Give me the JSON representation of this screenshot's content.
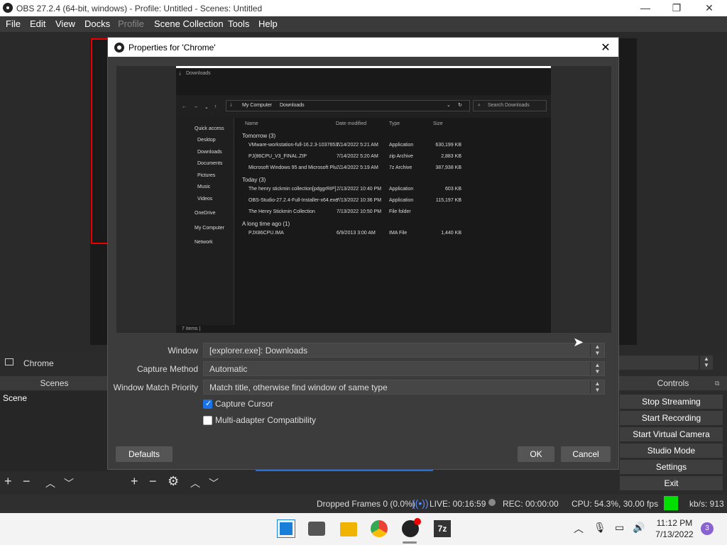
{
  "window": {
    "title": "OBS 27.2.4 (64-bit, windows) - Profile: Untitled - Scenes: Untitled",
    "min": "—",
    "max": "❐",
    "close": "✕"
  },
  "menu": [
    "File",
    "Edit",
    "View",
    "Docks",
    "Profile",
    "Scene Collection",
    "Tools",
    "Help"
  ],
  "dialog": {
    "title": "Properties for 'Chrome'",
    "close": "✕",
    "window_label": "Window",
    "window_value": "[explorer.exe]: Downloads",
    "method_label": "Capture Method",
    "method_value": "Automatic",
    "priority_label": "Window Match Priority",
    "priority_value": "Match title, otherwise find window of same type",
    "capture_cursor": "Capture Cursor",
    "capture_cursor_checked": true,
    "multi_adapter": "Multi-adapter Compatibility",
    "multi_adapter_checked": false,
    "defaults": "Defaults",
    "ok": "OK",
    "cancel": "Cancel"
  },
  "explorer": {
    "title": "Downloads",
    "path_a": "My Computer",
    "path_b": "Downloads",
    "search": "Search Downloads",
    "nav": [
      "Quick access",
      "Desktop",
      "Downloads",
      "Documents",
      "Pictures",
      "Music",
      "Videos",
      "OneDrive",
      "My Computer",
      "Network"
    ],
    "col_name": "Name",
    "col_date": "Date modified",
    "col_type": "Type",
    "col_size": "Size",
    "group1": "Tomorrow (3)",
    "group2": "Today (3)",
    "group3": "A long time ago (1)",
    "rows": [
      {
        "name": "VMware-workstation-full-16.2.3-1037653...",
        "date": "7/14/2022 5:21 AM",
        "type": "Application",
        "size": "630,199 KB"
      },
      {
        "name": "PJ(86CPU_V3_FINAL.ZIP",
        "date": "7/14/2022 5:20 AM",
        "type": "zip Archive",
        "size": "2,883 KB"
      },
      {
        "name": "Microsoft Windows 95 and Microsoft Plu...",
        "date": "7/14/2022 5:19 AM",
        "type": "7z Archive",
        "size": "387,938 KB"
      },
      {
        "name": "The henry stickmin collection[pdggrRIP]...",
        "date": "7/13/2022 10:40 PM",
        "type": "Application",
        "size": "603 KB"
      },
      {
        "name": "OBS-Studio-27.2.4-Full-Installer-x64.exe",
        "date": "7/13/2022 10:36 PM",
        "type": "Application",
        "size": "115,197 KB"
      },
      {
        "name": "The Henry Stickmin Collection",
        "date": "7/13/2022 10:50 PM",
        "type": "File folder",
        "size": ""
      },
      {
        "name": "PJX86CPU.IMA",
        "date": "6/9/2013 3:00 AM",
        "type": "IMA File",
        "size": "1,440 KB"
      }
    ],
    "status": "7 items  |"
  },
  "source_name": "Chrome",
  "scenes_header": "Scenes",
  "scene_item": "Scene",
  "controls_header": "Controls",
  "controls": [
    "Stop Streaming",
    "Start Recording",
    "Start Virtual Camera",
    "Studio Mode",
    "Settings",
    "Exit"
  ],
  "status": {
    "dropped": "Dropped Frames 0 (0.0%)",
    "live": "LIVE: 00:16:59",
    "rec": "REC: 00:00:00",
    "cpu": "CPU: 54.3%, 30.00 fps",
    "kbs": "kb/s: 913",
    "indicator_color": "#00e000"
  },
  "taskbar": {
    "time": "11:12 PM",
    "date": "7/13/2022",
    "badge": "3"
  }
}
